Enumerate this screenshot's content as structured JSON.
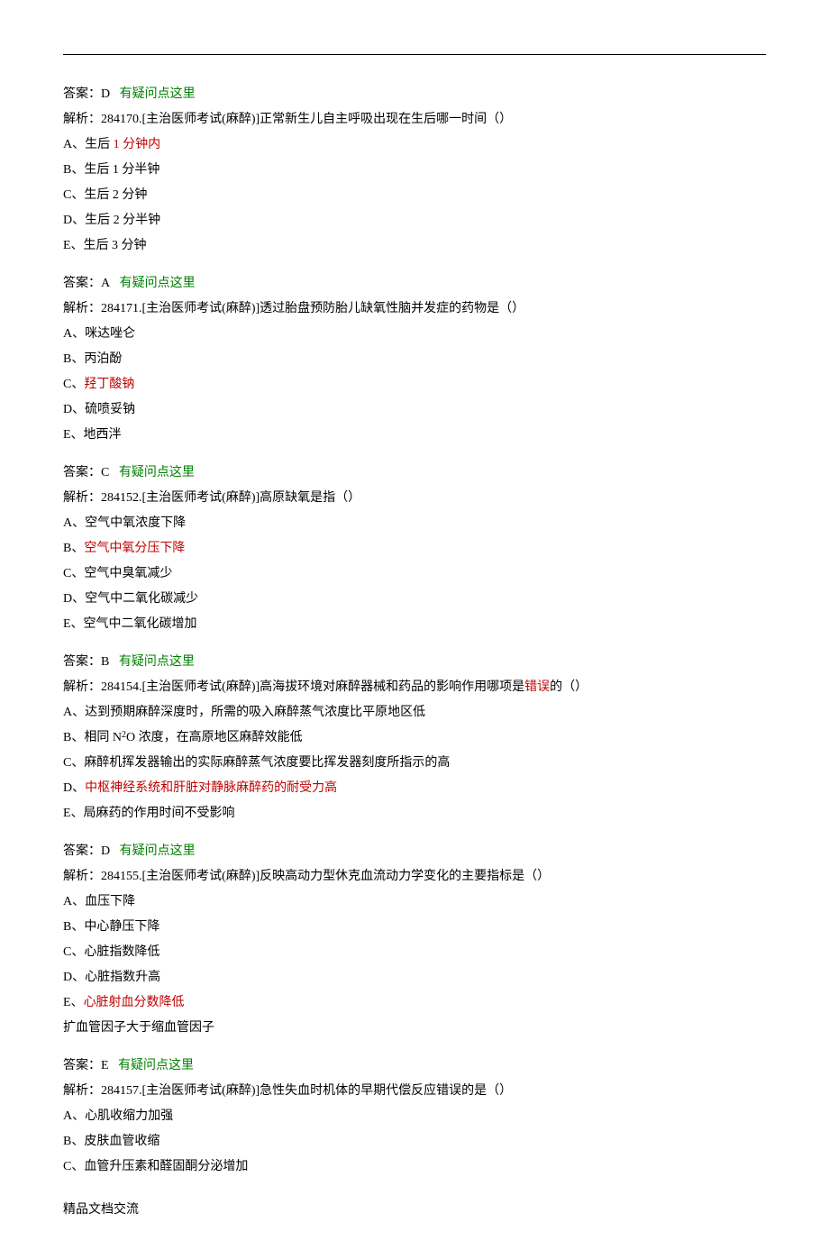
{
  "hr": "",
  "q1": {
    "answer_label": "答案：D",
    "link": "有疑问点这里",
    "stem": "解析：284170.[主治医师考试(麻醉)]正常新生儿自主呼吸出现在生后哪一时间（）",
    "optA_pre": "A、生后 ",
    "optA_red": "1 分钟内",
    "optB": "B、生后 1 分半钟",
    "optC": "C、生后 2 分钟",
    "optD": "D、生后 2 分半钟",
    "optE": "E、生后 3 分钟"
  },
  "q2": {
    "answer_label": "答案：A",
    "link": "有疑问点这里",
    "stem": "解析：284171.[主治医师考试(麻醉)]透过胎盘预防胎儿缺氧性脑并发症的药物是（）",
    "optA": "A、咪达唑仑",
    "optB": "B、丙泊酚",
    "optC_pre": "C、",
    "optC_red": "羟丁酸钠",
    "optD": "D、硫喷妥钠",
    "optE": "E、地西泮"
  },
  "q3": {
    "answer_label": "答案：C",
    "link": "有疑问点这里",
    "stem": "解析：284152.[主治医师考试(麻醉)]高原缺氧是指（）",
    "optA": "A、空气中氧浓度下降",
    "optB_pre": "B、",
    "optB_red": "空气中氧分压下降",
    "optC": "C、空气中臭氧减少",
    "optD": "D、空气中二氧化碳减少",
    "optE": "E、空气中二氧化碳增加"
  },
  "q4": {
    "answer_label": "答案：B",
    "link": "有疑问点这里",
    "stem_pre": "解析：284154.[主治医师考试(麻醉)]高海拔环境对麻醉器械和药品的影响作用哪项是",
    "stem_red": "错误",
    "stem_post": "的（）",
    "optA": "A、达到预期麻醉深度时，所需的吸入麻醉蒸气浓度比平原地区低",
    "optB_pre": "B、相同 N",
    "optB_sup": "2",
    "optB_post": "O 浓度，在高原地区麻醉效能低",
    "optC": "C、麻醉机挥发器输出的实际麻醉蒸气浓度要比挥发器刻度所指示的高",
    "optD_pre": "D、",
    "optD_red": "中枢神经系统和肝脏对静脉麻醉药的耐受力高",
    "optE": "E、局麻药的作用时间不受影响"
  },
  "q5": {
    "answer_label": "答案：D",
    "link": "有疑问点这里",
    "stem": "解析：284155.[主治医师考试(麻醉)]反映高动力型休克血流动力学变化的主要指标是（）",
    "optA": "A、血压下降",
    "optB": "B、中心静压下降",
    "optC": "C、心脏指数降低",
    "optD": "D、心脏指数升高",
    "optE_pre": "E、",
    "optE_red": "心脏射血分数降低",
    "note": "扩血管因子大于缩血管因子"
  },
  "q6": {
    "answer_label": "答案：E",
    "link": "有疑问点这里",
    "stem": "解析：284157.[主治医师考试(麻醉)]急性失血时机体的早期代偿反应错误的是（）",
    "optA": "A、心肌收缩力加强",
    "optB": "B、皮肤血管收缩",
    "optC": "C、血管升压素和醛固酮分泌增加"
  },
  "footer": "精品文档交流"
}
